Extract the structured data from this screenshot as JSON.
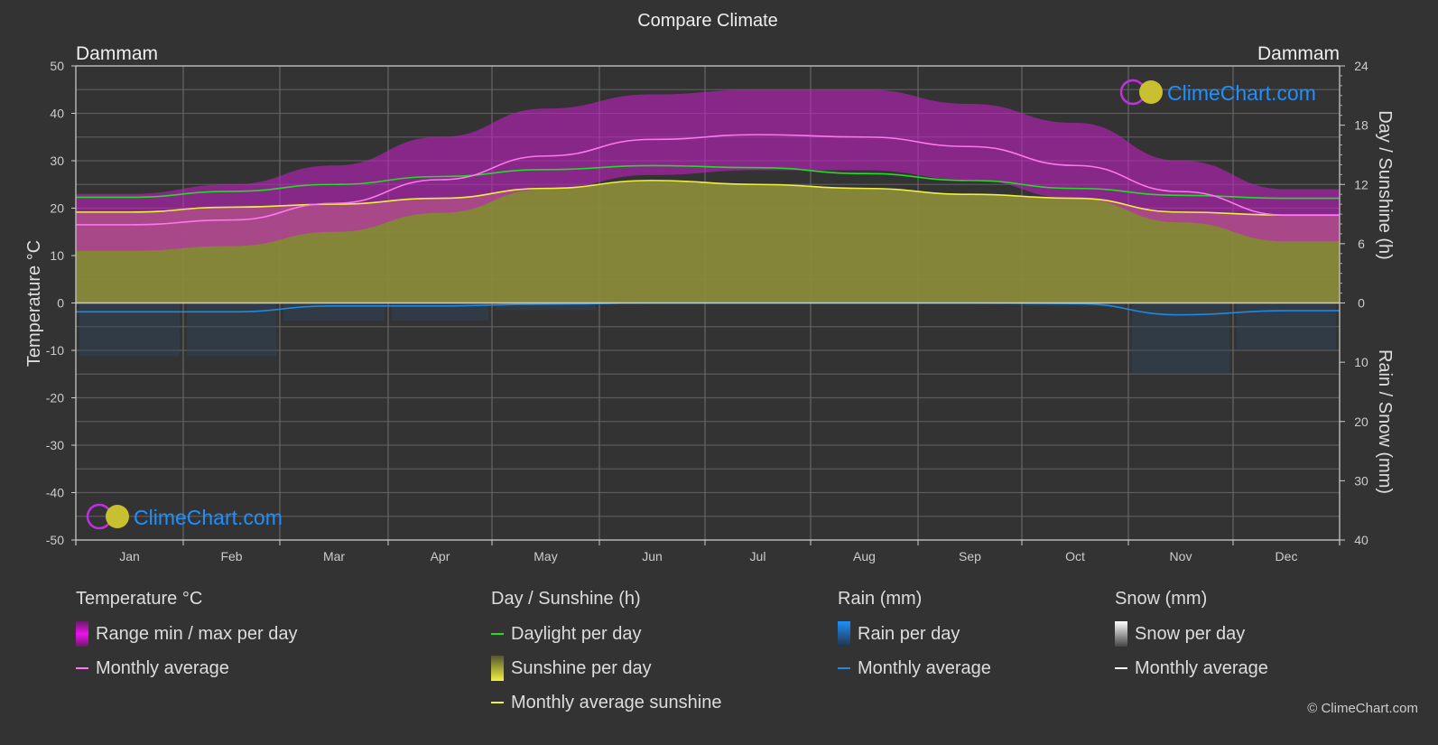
{
  "title": "Compare Climate",
  "location_left": "Dammam",
  "location_right": "Dammam",
  "watermark": "ClimeChart.com",
  "copyright": "© ClimeChart.com",
  "colors": {
    "background": "#333333",
    "grid": "#5a5a5a",
    "temp_range": "#c020c0",
    "temp_avg": "#ff77ee",
    "daylight": "#22dd22",
    "sunshine_fill": "#8a8a3a",
    "sunshine_avg": "#f0f040",
    "rain": "#1e88e5",
    "snow": "#ffffff",
    "brand": "#1e90ff"
  },
  "legend": {
    "temperature": {
      "title": "Temperature °C",
      "range_label": "Range min / max per day",
      "avg_label": "Monthly average"
    },
    "sunshine": {
      "title": "Day / Sunshine (h)",
      "daylight_label": "Daylight per day",
      "sunshine_label": "Sunshine per day",
      "avg_label": "Monthly average sunshine"
    },
    "rain": {
      "title": "Rain (mm)",
      "per_day_label": "Rain per day",
      "avg_label": "Monthly average"
    },
    "snow": {
      "title": "Snow (mm)",
      "per_day_label": "Snow per day",
      "avg_label": "Monthly average"
    }
  },
  "chart_data": {
    "type": "area",
    "title": "Compare Climate",
    "categories": [
      "Jan",
      "Feb",
      "Mar",
      "Apr",
      "May",
      "Jun",
      "Jul",
      "Aug",
      "Sep",
      "Oct",
      "Nov",
      "Dec"
    ],
    "left_axis": {
      "label": "Temperature °C",
      "range": [
        -50,
        50
      ],
      "ticks": [
        50,
        40,
        30,
        20,
        10,
        0,
        -10,
        -20,
        -30,
        -40,
        -50
      ]
    },
    "right_axis_top": {
      "label": "Day / Sunshine (h)",
      "range": [
        0,
        24
      ],
      "ticks": [
        24,
        18,
        12,
        6,
        0
      ]
    },
    "right_axis_bottom": {
      "label": "Rain / Snow (mm)",
      "range": [
        0,
        40
      ],
      "ticks": [
        0,
        10,
        20,
        30,
        40
      ]
    },
    "grid": true,
    "series": [
      {
        "name": "Temperature monthly average",
        "axis": "left",
        "values": [
          16.5,
          17.5,
          21,
          26,
          31,
          34.5,
          35.5,
          35,
          33,
          29,
          23.5,
          18.5
        ]
      },
      {
        "name": "Temperature daily max (approx)",
        "axis": "left",
        "values": [
          23,
          25,
          29,
          35,
          41,
          44,
          45,
          45,
          42,
          38,
          30,
          24
        ]
      },
      {
        "name": "Temperature daily min (approx)",
        "axis": "left",
        "values": [
          11,
          12,
          15,
          19,
          24,
          27,
          28,
          28,
          26,
          22,
          17,
          13
        ]
      },
      {
        "name": "Daylight per day",
        "axis": "right_top",
        "values": [
          10.7,
          11.3,
          12,
          12.8,
          13.5,
          13.9,
          13.7,
          13.1,
          12.4,
          11.6,
          10.9,
          10.6
        ]
      },
      {
        "name": "Monthly average sunshine",
        "axis": "right_top",
        "values": [
          9.2,
          9.7,
          10,
          10.6,
          11.6,
          12.4,
          12,
          11.6,
          11,
          10.6,
          9.2,
          8.9
        ]
      },
      {
        "name": "Rain monthly average",
        "axis": "right_bottom",
        "values": [
          1.5,
          1.5,
          0.5,
          0.5,
          0.2,
          0,
          0,
          0,
          0,
          0.1,
          2,
          1.3
        ]
      },
      {
        "name": "Snow monthly average",
        "axis": "right_bottom",
        "values": [
          0,
          0,
          0,
          0,
          0,
          0,
          0,
          0,
          0,
          0,
          0,
          0
        ]
      }
    ],
    "legend_position": "bottom"
  }
}
